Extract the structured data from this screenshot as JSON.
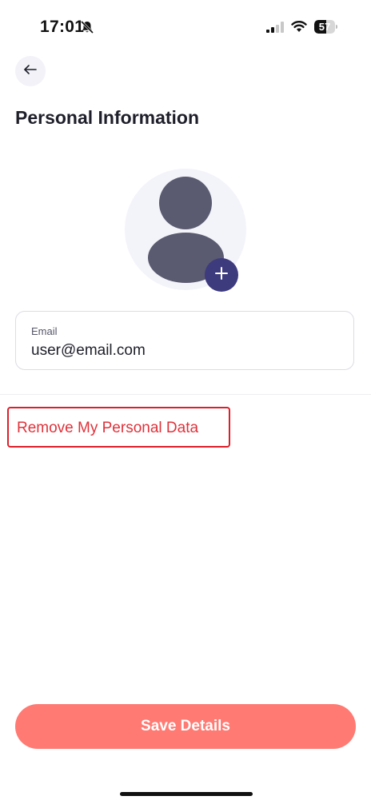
{
  "status_bar": {
    "time": "17:01",
    "battery_level": "57",
    "battery_fraction": 0.57,
    "icons": [
      "bell-slash-icon",
      "signal-icon",
      "wifi-icon",
      "battery-icon"
    ]
  },
  "header": {
    "back_icon": "arrow-left-icon",
    "title": "Personal Information"
  },
  "avatar": {
    "placeholder_icon": "person-silhouette-icon",
    "add_icon": "plus-icon"
  },
  "email": {
    "label": "Email",
    "value": "user@email.com"
  },
  "actions": {
    "remove_data_label": "Remove My Personal Data",
    "save_label": "Save Details"
  },
  "colors": {
    "accent_purple": "#3e3a7e",
    "avatar_gray": "#5a5a70",
    "danger_red": "#e0323a",
    "save_button": "#ff7a73"
  }
}
